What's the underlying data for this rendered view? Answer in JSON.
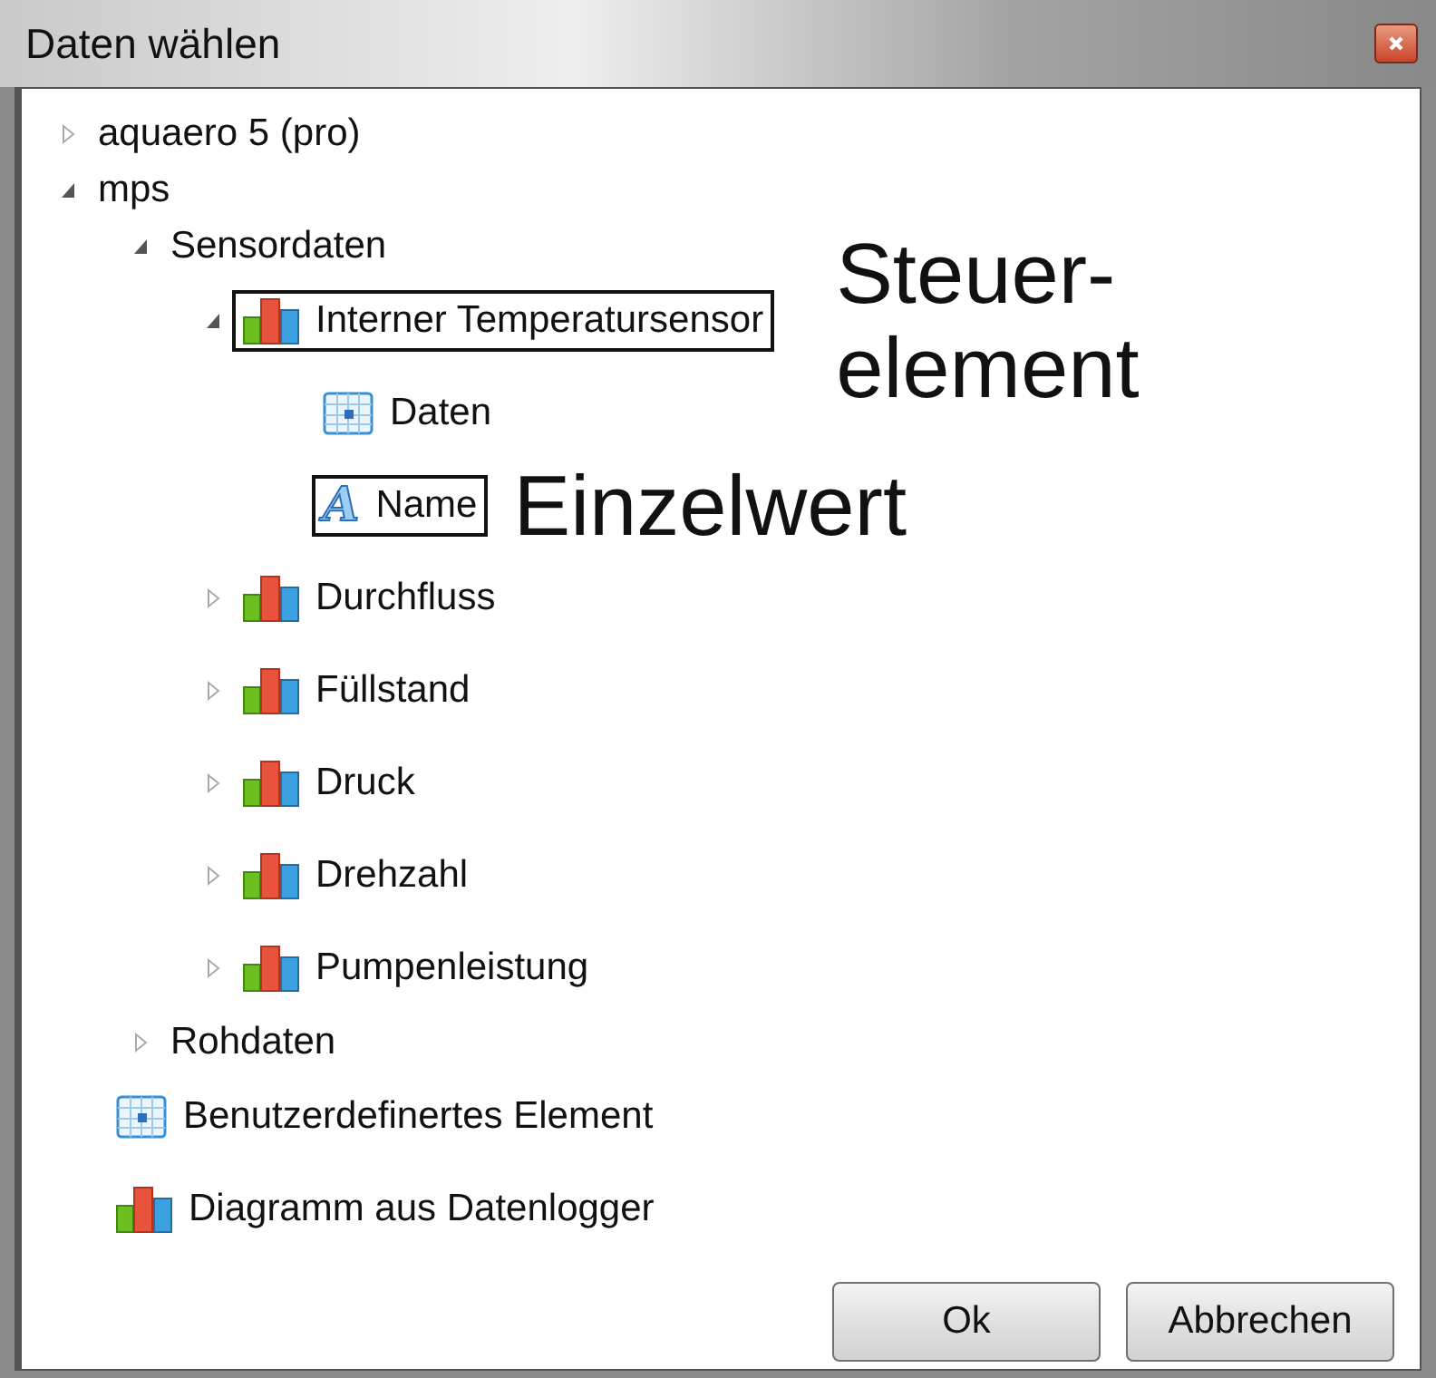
{
  "window": {
    "title": "Daten wählen"
  },
  "tree": [
    {
      "label": "aquaero 5 (pro)",
      "expanded": false
    },
    {
      "label": "mps",
      "expanded": true,
      "children": [
        {
          "label": "Sensordaten",
          "expanded": true,
          "children": [
            {
              "label": "Interner Temperatursensor",
              "kind": "chart",
              "expanded": true,
              "boxed": true,
              "annotation": "Steuer-element",
              "children": [
                {
                  "label": "Daten",
                  "kind": "table"
                },
                {
                  "label": "Name",
                  "kind": "text",
                  "glyph": "A",
                  "boxed": true,
                  "annotation": "Einzelwert"
                }
              ]
            },
            {
              "label": "Durchfluss",
              "kind": "chart",
              "expanded": false
            },
            {
              "label": "Füllstand",
              "kind": "chart",
              "expanded": false
            },
            {
              "label": "Druck",
              "kind": "chart",
              "expanded": false
            },
            {
              "label": "Drehzahl",
              "kind": "chart",
              "expanded": false
            },
            {
              "label": "Pumpenleistung",
              "kind": "chart",
              "expanded": false
            }
          ]
        },
        {
          "label": "Rohdaten",
          "expanded": false
        }
      ]
    },
    {
      "label": "Benutzerdefinertes Element",
      "kind": "table"
    },
    {
      "label": "Diagramm aus Datenlogger",
      "kind": "chart"
    }
  ],
  "buttons": [
    "Ok",
    "Abbrechen"
  ]
}
